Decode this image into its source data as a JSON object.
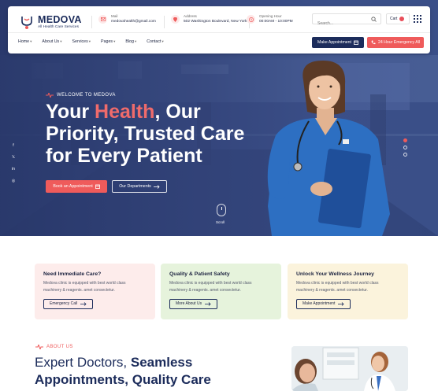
{
  "header": {
    "logo_name": "MEDOVA",
    "logo_tagline": "All Health Care Services",
    "mail_label": "Mail",
    "mail_value": "medovahealth@gmail.com",
    "address_label": "Address",
    "address_value": "502 Washington Boulevard, New York",
    "hours_label": "Opening Hour",
    "hours_value": "00:00AM - 10:00PM",
    "search_placeholder": "Search...",
    "cart_label": "Cart",
    "nav": [
      {
        "label": "Home",
        "chevron": "▾"
      },
      {
        "label": "About Us",
        "chevron": "▾"
      },
      {
        "label": "Services",
        "chevron": "▾"
      },
      {
        "label": "Pages",
        "chevron": "▾"
      },
      {
        "label": "Blog",
        "chevron": "▾"
      },
      {
        "label": "Contact",
        "chevron": "▾"
      }
    ],
    "make_appointment": "Make Appointment",
    "emergency": "24 Hour Emergency All"
  },
  "hero": {
    "welcome": "WELCOME TO MEDOVA",
    "title_part1": "Your ",
    "title_accent": "Health",
    "title_part2": ", Our Priority, Trusted Care for Every Patient",
    "book_button": "Book an Appointment",
    "departments_button": "Our Departments",
    "scroll_label": "Scroll",
    "social": [
      "f",
      "𝕏",
      "in",
      "◎"
    ]
  },
  "cards": [
    {
      "title": "Need Immediate Care?",
      "text": "Medova clinic is equipped with best world class machinery & reagents. amet consectetur.",
      "button": "Emergency Call",
      "color": "#fdeceb"
    },
    {
      "title": "Quality & Patient Safety",
      "text": "Medova clinic is equipped with best world class machinery & reagents. amet consectetur.",
      "button": "More About Us",
      "color": "#e6f3dc"
    },
    {
      "title": "Unlock Your Wellness Journey",
      "text": "Medova clinic is equipped with best world class machinery & reagents. amet consectetur.",
      "button": "Make Appointment",
      "color": "#fbf3dc"
    }
  ],
  "about": {
    "tag": "ABOUT US",
    "title_part1": "Expert Doctors, ",
    "title_bold1": "Seamless",
    "title_bold2": "Appointments, Quality Care"
  },
  "colors": {
    "navy": "#1c2c5b",
    "accent_red": "#ef5b5b"
  }
}
